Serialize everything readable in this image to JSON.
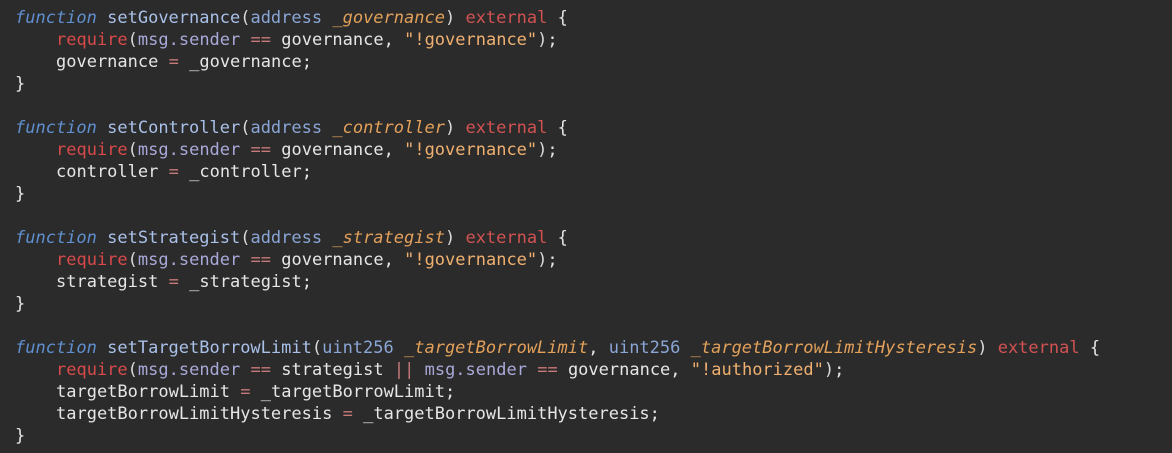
{
  "code": {
    "functions": [
      {
        "keyword": "function",
        "name": "setGovernance",
        "params": [
          {
            "type": "address",
            "name": "_governance"
          }
        ],
        "modifier": "external",
        "require": {
          "fn": "require",
          "condition": [
            "msg.sender",
            "==",
            "governance"
          ],
          "message": "\"!governance\""
        },
        "assignments": [
          {
            "target": "governance",
            "value": "_governance"
          }
        ]
      },
      {
        "keyword": "function",
        "name": "setController",
        "params": [
          {
            "type": "address",
            "name": "_controller"
          }
        ],
        "modifier": "external",
        "require": {
          "fn": "require",
          "condition": [
            "msg.sender",
            "==",
            "governance"
          ],
          "message": "\"!governance\""
        },
        "assignments": [
          {
            "target": "controller",
            "value": "_controller"
          }
        ]
      },
      {
        "keyword": "function",
        "name": "setStrategist",
        "params": [
          {
            "type": "address",
            "name": "_strategist"
          }
        ],
        "modifier": "external",
        "require": {
          "fn": "require",
          "condition": [
            "msg.sender",
            "==",
            "governance"
          ],
          "message": "\"!governance\""
        },
        "assignments": [
          {
            "target": "strategist",
            "value": "_strategist"
          }
        ]
      },
      {
        "keyword": "function",
        "name": "setTargetBorrowLimit",
        "params": [
          {
            "type": "uint256",
            "name": "_targetBorrowLimit"
          },
          {
            "type": "uint256",
            "name": "_targetBorrowLimitHysteresis"
          }
        ],
        "modifier": "external",
        "require": {
          "fn": "require",
          "condition": [
            "msg.sender",
            "==",
            "strategist",
            "||",
            "msg.sender",
            "==",
            "governance"
          ],
          "message": "\"!authorized\""
        },
        "assignments": [
          {
            "target": "targetBorrowLimit",
            "value": "_targetBorrowLimit"
          },
          {
            "target": "targetBorrowLimitHysteresis",
            "value": "_targetBorrowLimitHysteresis"
          }
        ]
      }
    ],
    "punct": {
      "open_paren": "(",
      "close_paren": ")",
      "comma": ", ",
      "open_brace": "{",
      "close_brace": "}",
      "assign": "=",
      "semicolon": ";"
    }
  }
}
